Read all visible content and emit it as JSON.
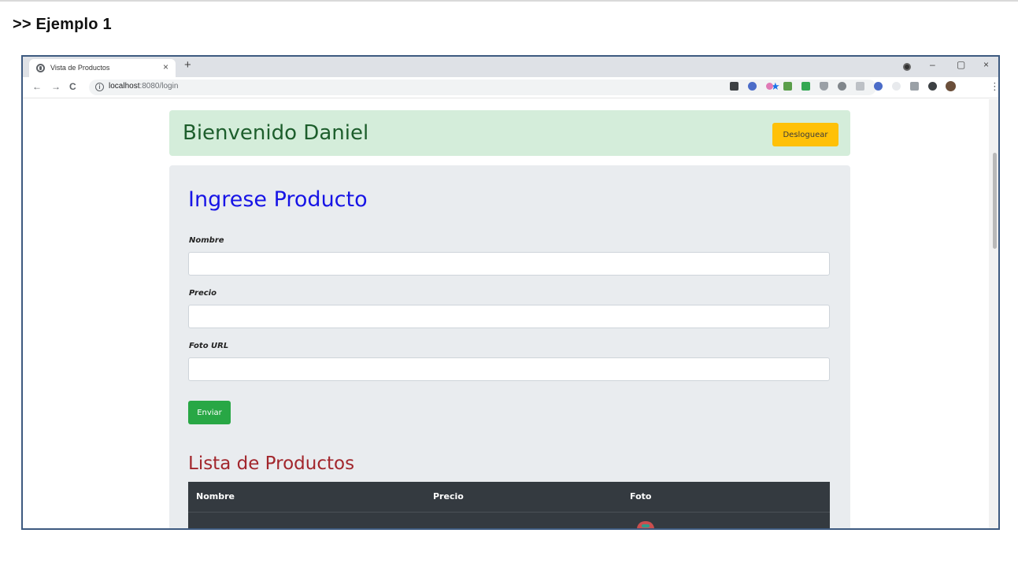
{
  "doc": {
    "heading": ">> Ejemplo 1"
  },
  "browser": {
    "tab_title": "Vista de Productos",
    "tab_close": "×",
    "new_tab": "+",
    "url_host": "localhost",
    "url_rest": ":8080/login",
    "nav": {
      "back": "←",
      "forward": "→",
      "reload": "C"
    },
    "window": {
      "minimize": "–",
      "maximize": "▢",
      "close": "×"
    },
    "star": "★",
    "menu": "⋮",
    "info": "i"
  },
  "header": {
    "welcome": "Bienvenido Daniel",
    "logout_label": "Desloguear",
    "color": "#d4edda"
  },
  "form": {
    "title": "Ingrese Producto",
    "fields": [
      {
        "label": "Nombre",
        "value": ""
      },
      {
        "label": "Precio",
        "value": ""
      },
      {
        "label": "Foto URL",
        "value": ""
      }
    ],
    "submit_label": "Enviar"
  },
  "list": {
    "title": "Lista de Productos",
    "columns": [
      "Nombre",
      "Precio",
      "Foto"
    ]
  },
  "colors": {
    "accent_blue": "#1714e6",
    "list_red": "#a2262c",
    "warning": "#ffc107",
    "success": "#28a745",
    "table_dark": "#343a40"
  }
}
